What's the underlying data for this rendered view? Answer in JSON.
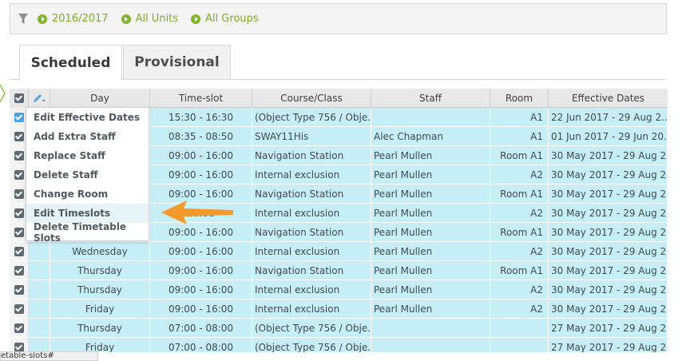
{
  "filters": {
    "year": "2016/2017",
    "units": "All Units",
    "groups": "All Groups"
  },
  "tabs": {
    "scheduled": "Scheduled",
    "provisional": "Provisional"
  },
  "columns": {
    "day": "Day",
    "timeslot": "Time-slot",
    "course": "Course/Class",
    "staff": "Staff",
    "room": "Room",
    "dates": "Effective Dates"
  },
  "rows": [
    {
      "day": "",
      "time": "15:30 - 16:30",
      "course": "(Object Type 756 / Obje...",
      "staff": "",
      "room": "A1",
      "dates": "22 Jun 2017 - 29 Aug 2..."
    },
    {
      "day": "",
      "time": "08:35 - 08:50",
      "course": "SWAY11His",
      "staff": "Alec Chapman",
      "room": "A1",
      "dates": "01 Jun 2017 - 29 Jun 20..."
    },
    {
      "day": "",
      "time": "09:00 - 16:00",
      "course": "Navigation Station",
      "staff": "Pearl Mullen",
      "room": "Room A1",
      "dates": "30 May 2017 - 29 Aug 2..."
    },
    {
      "day": "",
      "time": "09:00 - 16:00",
      "course": "Internal exclusion",
      "staff": "Pearl Mullen",
      "room": "A2",
      "dates": "30 May 2017 - 29 Aug 2..."
    },
    {
      "day": "",
      "time": "09:00 - 16:00",
      "course": "Navigation Station",
      "staff": "Pearl Mullen",
      "room": "Room A1",
      "dates": "30 May 2017 - 29 Aug 2..."
    },
    {
      "day": "",
      "time": "16:00",
      "course": "Internal exclusion",
      "staff": "Pearl Mullen",
      "room": "A2",
      "dates": "30 May 2017 - 29 Aug 2..."
    },
    {
      "day": "",
      "time": "09:00 - 16:00",
      "course": "Navigation Station",
      "staff": "Pearl Mullen",
      "room": "Room A1",
      "dates": "30 May 2017 - 29 Aug 2..."
    },
    {
      "day": "Wednesday",
      "time": "09:00 - 16:00",
      "course": "Internal exclusion",
      "staff": "Pearl Mullen",
      "room": "A2",
      "dates": "30 May 2017 - 29 Aug 2..."
    },
    {
      "day": "Thursday",
      "time": "09:00 - 16:00",
      "course": "Navigation Station",
      "staff": "Pearl Mullen",
      "room": "Room A1",
      "dates": "30 May 2017 - 29 Aug 2..."
    },
    {
      "day": "Thursday",
      "time": "09:00 - 16:00",
      "course": "Internal exclusion",
      "staff": "Pearl Mullen",
      "room": "A2",
      "dates": "30 May 2017 - 29 Aug 2..."
    },
    {
      "day": "Friday",
      "time": "09:00 - 16:00",
      "course": "Internal exclusion",
      "staff": "Pearl Mullen",
      "room": "A2",
      "dates": "30 May 2017 - 29 Aug 2..."
    },
    {
      "day": "Thursday",
      "time": "07:00 - 08:00",
      "course": "(Object Type 756 / Obje...",
      "staff": "",
      "room": "",
      "dates": "27 May 2017 - 29 Aug 2..."
    },
    {
      "day": "Friday",
      "time": "07:00 - 08:00",
      "course": "(Object Type 756 / Obje...",
      "staff": "",
      "room": "",
      "dates": "27 May 2017 - 29 Aug 2..."
    }
  ],
  "menu": {
    "items": [
      "Edit Effective Dates",
      "Add Extra Staff",
      "Replace Staff",
      "Delete Staff",
      "Change Room",
      "Edit Timeslots",
      "Delete Timetable Slots"
    ],
    "highlighted_index": 5
  },
  "status": {
    "url_fragment": "etable-slots#"
  },
  "colors": {
    "accent_green": "#7cae2a",
    "row_fill": "#c7eef7",
    "arrow_orange": "#f39a2b",
    "checkbox_blue": "#4aa3df"
  }
}
